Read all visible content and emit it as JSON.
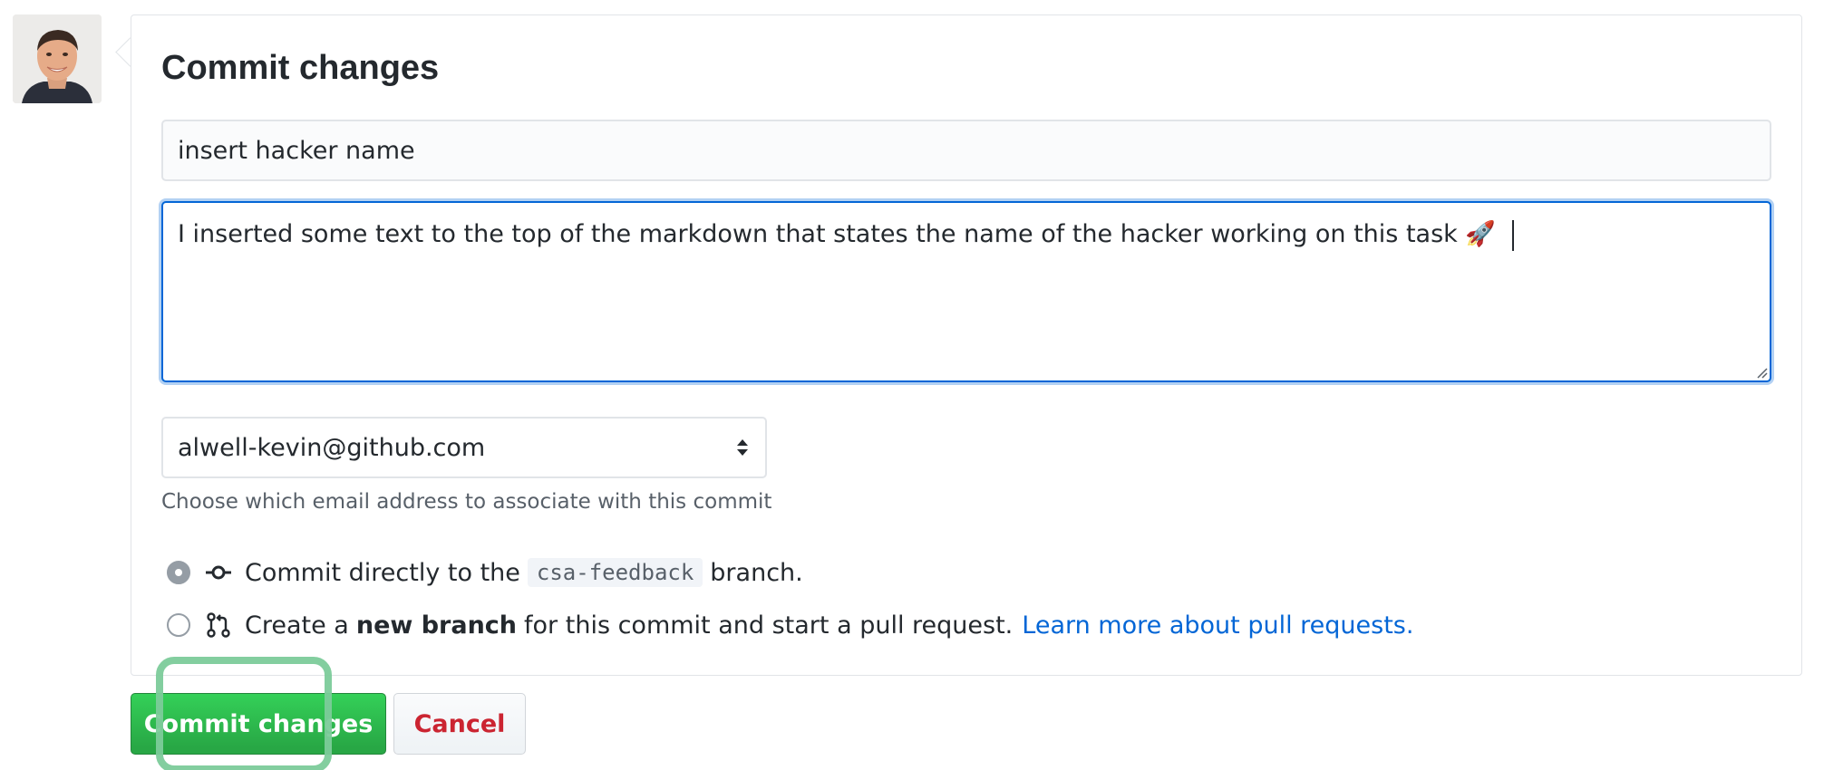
{
  "avatar": {
    "icon": "user-avatar"
  },
  "panel": {
    "title": "Commit changes",
    "summary_value": "insert hacker name",
    "description_value": "I inserted some text to the top of the markdown that states the name of the hacker working on this task 🚀",
    "email_selected": "alwell-kevin@github.com",
    "email_note": "Choose which email address to associate with this commit",
    "options": {
      "direct": {
        "prefix": "Commit directly to the",
        "branch": "csa-feedback",
        "suffix": "branch.",
        "checked": true,
        "icon": "git-commit-icon"
      },
      "new_branch": {
        "prefix": "Create a",
        "bold": "new branch",
        "suffix": "for this commit and start a pull request.",
        "link": "Learn more about pull requests.",
        "checked": false,
        "icon": "git-pull-request-icon"
      }
    }
  },
  "buttons": {
    "commit": "Commit changes",
    "cancel": "Cancel"
  },
  "colors": {
    "primary_green": "#28a745",
    "cancel_red": "#cb2431",
    "link_blue": "#0366d6",
    "focus_blue": "#0366d6",
    "highlight_green": "#7ccb9a"
  }
}
